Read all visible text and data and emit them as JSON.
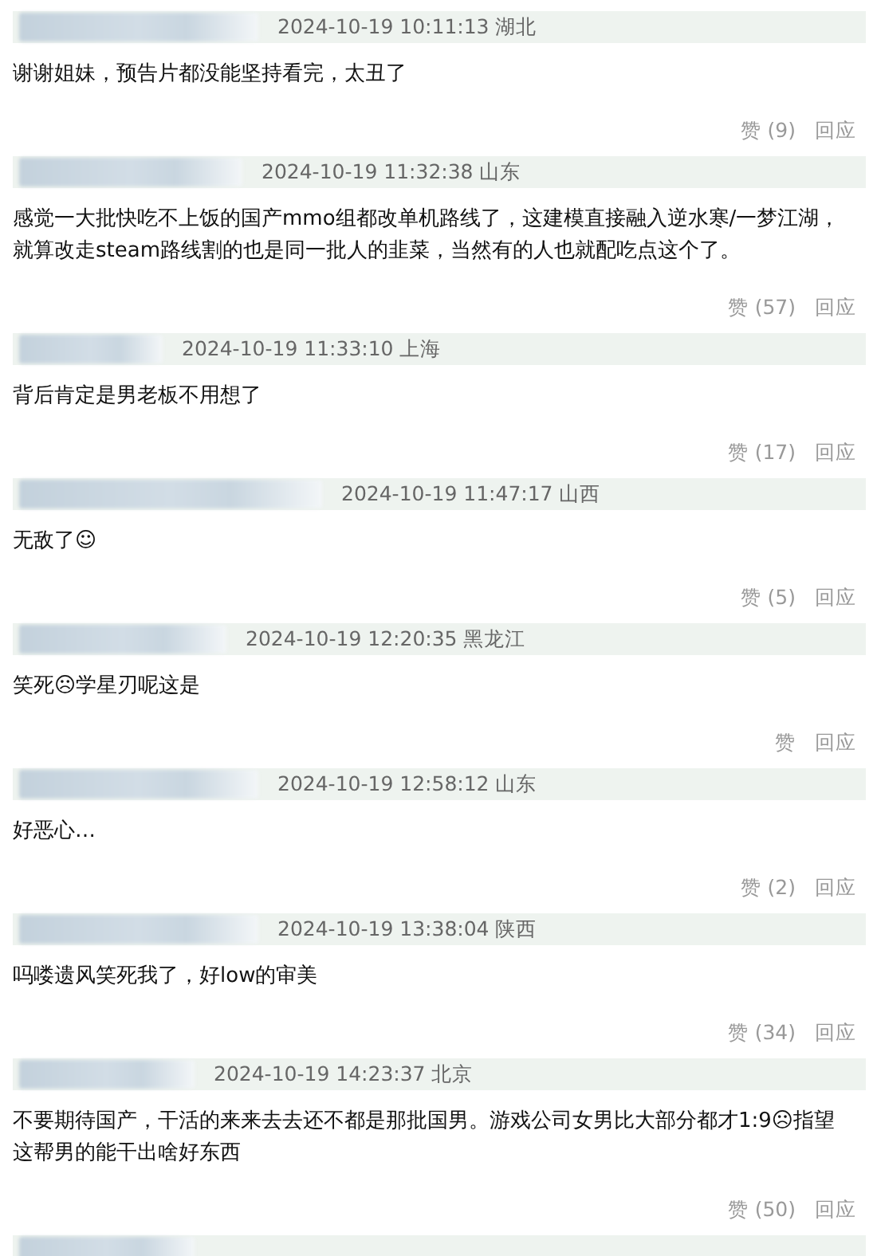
{
  "comments": [
    {
      "kind": "full",
      "meta": "2024-10-19 10:11:13 湖北",
      "text": "谢谢姐妹，预告片都没能坚持看完，太丑了",
      "likes": "赞 (9)",
      "reply": "回应"
    },
    {
      "kind": "full",
      "meta": "2024-10-19 11:32:38 山东",
      "text": "感觉一大批快吃不上饭的国产mmo组都改单机路线了，这建模直接融入逆水寒/一梦江湖，就算改走steam路线割的也是同一批人的韭菜，当然有的人也就配吃点这个了。",
      "likes": "赞 (57)",
      "reply": "回应"
    },
    {
      "kind": "full",
      "meta": "2024-10-19 11:33:10 上海",
      "text": "背后肯定是男老板不用想了",
      "likes": "赞 (17)",
      "reply": "回应"
    },
    {
      "kind": "full",
      "meta": "2024-10-19 11:47:17 山西",
      "text": "无敌了☺",
      "likes": "赞 (5)",
      "reply": "回应"
    },
    {
      "kind": "full",
      "meta": "2024-10-19 12:20:35 黑龙江",
      "text": "笑死☹学星刃呢这是",
      "likes": "赞",
      "reply": "回应"
    },
    {
      "kind": "full",
      "meta": "2024-10-19 12:58:12 山东",
      "text": "好恶心…",
      "likes": "赞 (2)",
      "reply": "回应"
    },
    {
      "kind": "full",
      "meta": "2024-10-19 13:38:04 陕西",
      "text": "吗喽遗风笑死我了，好low的审美",
      "likes": "赞 (34)",
      "reply": "回应"
    },
    {
      "kind": "full",
      "meta": "2024-10-19 14:23:37 北京",
      "text": "不要期待国产，干活的来来去去还不都是那批国男。游戏公司女男比大部分都才1:9☹指望这帮男的能干出啥好东西",
      "likes": "赞 (50)",
      "reply": "回应"
    },
    {
      "kind": "cut"
    }
  ]
}
